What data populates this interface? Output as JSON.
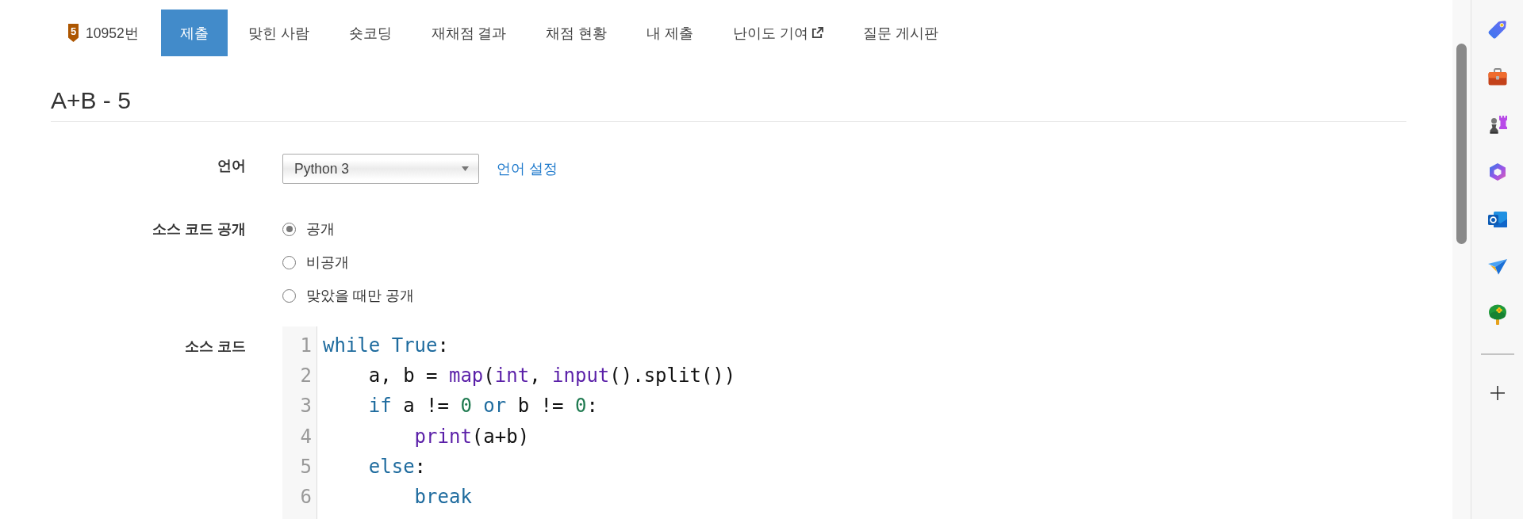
{
  "problem_nav": {
    "problem": {
      "tier_badge": "5",
      "label": "10952번"
    },
    "tabs": [
      {
        "label": "제출",
        "selected": true,
        "external": false
      },
      {
        "label": "맞힌 사람",
        "selected": false,
        "external": false
      },
      {
        "label": "숏코딩",
        "selected": false,
        "external": false
      },
      {
        "label": "재채점 결과",
        "selected": false,
        "external": false
      },
      {
        "label": "채점 현황",
        "selected": false,
        "external": false
      },
      {
        "label": "내 제출",
        "selected": false,
        "external": false
      },
      {
        "label": "난이도 기여",
        "selected": false,
        "external": true
      },
      {
        "label": "질문 게시판",
        "selected": false,
        "external": false
      }
    ]
  },
  "title": "A+B - 5",
  "form": {
    "language": {
      "label": "언어",
      "value": "Python 3",
      "link": "언어 설정"
    },
    "visibility": {
      "label": "소스 코드 공개",
      "options": [
        {
          "label": "공개",
          "selected": true
        },
        {
          "label": "비공개",
          "selected": false
        },
        {
          "label": "맞았을 때만 공개",
          "selected": false
        }
      ]
    },
    "source_code": {
      "label": "소스 코드",
      "lines": [
        {
          "number": "1",
          "tokens": [
            {
              "kind": "keyword",
              "text": "while"
            },
            {
              "kind": "keyword",
              "text": " True"
            },
            {
              "kind": "plain",
              "text": ":"
            }
          ]
        },
        {
          "number": "2",
          "tokens": [
            {
              "kind": "plain",
              "text": "    a, b = "
            },
            {
              "kind": "builtin",
              "text": "map"
            },
            {
              "kind": "plain",
              "text": "("
            },
            {
              "kind": "builtin",
              "text": "int"
            },
            {
              "kind": "plain",
              "text": ", "
            },
            {
              "kind": "builtin",
              "text": "input"
            },
            {
              "kind": "plain",
              "text": "().split())"
            }
          ]
        },
        {
          "number": "3",
          "tokens": [
            {
              "kind": "keyword",
              "text": "    if"
            },
            {
              "kind": "plain",
              "text": " a != "
            },
            {
              "kind": "number",
              "text": "0"
            },
            {
              "kind": "keyword",
              "text": " or"
            },
            {
              "kind": "plain",
              "text": " b != "
            },
            {
              "kind": "number",
              "text": "0"
            },
            {
              "kind": "plain",
              "text": ":"
            }
          ]
        },
        {
          "number": "4",
          "tokens": [
            {
              "kind": "builtin",
              "text": "        print"
            },
            {
              "kind": "plain",
              "text": "(a+b)"
            }
          ]
        },
        {
          "number": "5",
          "tokens": [
            {
              "kind": "keyword",
              "text": "    else"
            },
            {
              "kind": "plain",
              "text": ":"
            }
          ]
        },
        {
          "number": "6",
          "tokens": [
            {
              "kind": "keyword",
              "text": "        break"
            }
          ]
        }
      ]
    }
  }
}
